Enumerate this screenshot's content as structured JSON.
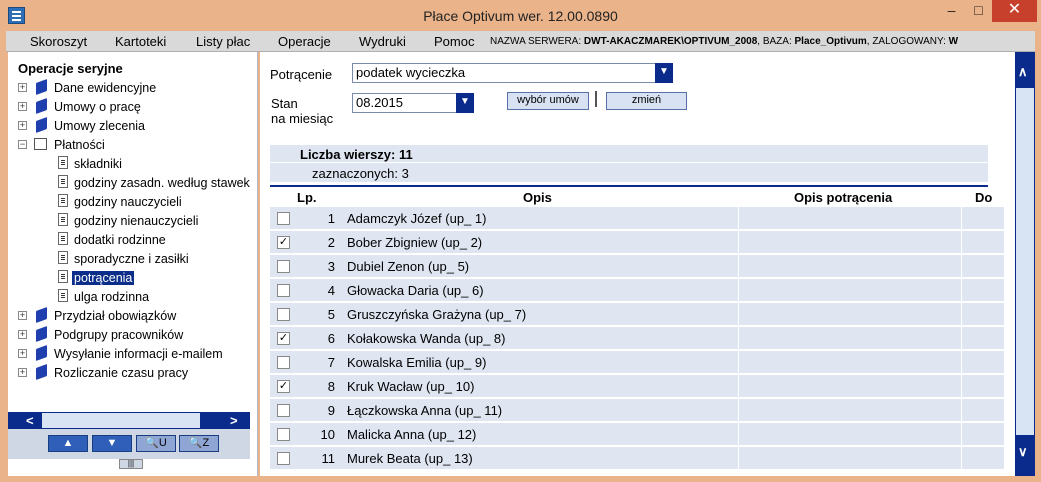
{
  "window": {
    "title": "Płace Optivum wer. 12.00.0890",
    "minimize": "–",
    "maximize": "□",
    "close": "✕"
  },
  "menu": [
    {
      "label": "Skoroszyt"
    },
    {
      "label": "Kartoteki"
    },
    {
      "label": "Listy płac"
    },
    {
      "label": "Operacje"
    },
    {
      "label": "Wydruki"
    },
    {
      "label": "Pomoc"
    }
  ],
  "server": {
    "server_label": "NAZWA SERWERA:",
    "server_value": "DWT-AKACZMAREK\\OPTIVUM_2008",
    "db_label": ", BAZA:",
    "db_value": "Place_Optivum",
    "user_label": ", ZALOGOWANY:",
    "user_value": "W"
  },
  "tree": {
    "root": "Operacje seryjne",
    "items": [
      {
        "label": "Dane ewidencyjne"
      },
      {
        "label": "Umowy o pracę"
      },
      {
        "label": "Umowy zlecenia"
      },
      {
        "label": "Płatności"
      },
      {
        "label": "składniki"
      },
      {
        "label": "godziny zasadn. według stawek"
      },
      {
        "label": "godziny nauczycieli"
      },
      {
        "label": "godziny nienauczycieli"
      },
      {
        "label": "dodatki rodzinne"
      },
      {
        "label": "sporadyczne i zasiłki"
      },
      {
        "label": "potrącenia"
      },
      {
        "label": "ulga rodzinna"
      },
      {
        "label": "Przydział obowiązków"
      },
      {
        "label": "Podgrupy pracowników"
      },
      {
        "label": "Wysyłanie informacji e-mailem"
      },
      {
        "label": "Rozliczanie czasu pracy"
      }
    ]
  },
  "form": {
    "potracenie_label": "Potrącenie",
    "potracenie_value": "podatek wycieczka",
    "stan_label_1": "Stan",
    "stan_label_2": "na miesiąc",
    "stan_value": "08.2015",
    "wybor_button": "wybór umów",
    "zmien_button": "zmień"
  },
  "summary": {
    "rows_count": "Liczba wierszy: 11",
    "selected_count": "zaznaczonych: 3"
  },
  "table": {
    "headers": {
      "lp": "Lp.",
      "opis": "Opis",
      "opis_potracenia": "Opis potrącenia",
      "do": "Do"
    },
    "rows": [
      {
        "lp": "1",
        "opis": "Adamczyk Józef (up_ 1)",
        "checked": ""
      },
      {
        "lp": "2",
        "opis": "Bober Zbigniew (up_ 2)",
        "checked": "✓"
      },
      {
        "lp": "3",
        "opis": "Dubiel Zenon (up_ 5)",
        "checked": ""
      },
      {
        "lp": "4",
        "opis": "Głowacka Daria (up_ 6)",
        "checked": ""
      },
      {
        "lp": "5",
        "opis": "Gruszczyńska Grażyna (up_ 7)",
        "checked": ""
      },
      {
        "lp": "6",
        "opis": "Kołakowska Wanda (up_ 8)",
        "checked": "✓"
      },
      {
        "lp": "7",
        "opis": "Kowalska Emilia (up_ 9)",
        "checked": ""
      },
      {
        "lp": "8",
        "opis": "Kruk Wacław (up_ 10)",
        "checked": "✓"
      },
      {
        "lp": "9",
        "opis": "Łączkowska Anna (up_ 11)",
        "checked": ""
      },
      {
        "lp": "10",
        "opis": "Malicka Anna (up_ 12)",
        "checked": ""
      },
      {
        "lp": "11",
        "opis": "Murek Beata (up_ 13)",
        "checked": ""
      }
    ]
  },
  "nav": {
    "up": "▲",
    "down": "▼",
    "find_u": "🔍U",
    "find_z": "🔍Z",
    "split": "|||"
  },
  "scroll": {
    "left": "<",
    "right": ">",
    "up": "∧",
    "down": "∨"
  }
}
